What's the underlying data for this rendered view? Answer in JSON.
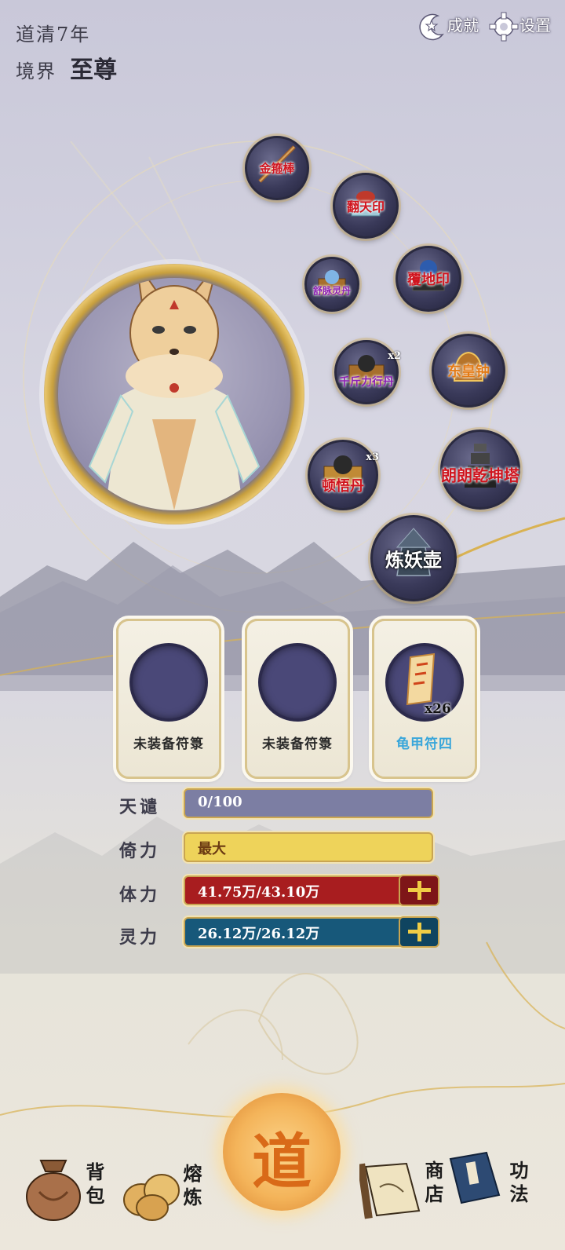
{
  "header": {
    "age_text": "道清7年",
    "realm_label": "境界",
    "realm_value": "至尊",
    "achievements_label": "成就",
    "settings_label": "设置"
  },
  "artifacts": [
    {
      "label": "金箍棒",
      "style": "red",
      "icon": "staff-icon"
    },
    {
      "label": "翻天印",
      "style": "red",
      "icon": "seal-icon"
    },
    {
      "label": "舒脉灵丹",
      "style": "purple",
      "icon": "chest-orb-icon"
    },
    {
      "label": "覆地印",
      "style": "red",
      "icon": "box-orb-icon"
    },
    {
      "label": "千斤力行丹",
      "style": "purple",
      "icon": "chest-ball-icon",
      "count": "x2"
    },
    {
      "label": "东皇钟",
      "style": "red",
      "icon": "bell-icon"
    },
    {
      "label": "顿悟丹",
      "style": "red",
      "icon": "chest-ball-icon",
      "count": "x3"
    },
    {
      "label": "朗朗乾坤塔",
      "style": "red",
      "icon": "tower-icon"
    },
    {
      "label": "炼妖壶",
      "style": "red",
      "icon": "pot-icon"
    }
  ],
  "talismans": [
    {
      "label": "未装备符箓",
      "equipped": false
    },
    {
      "label": "未装备符箓",
      "equipped": false
    },
    {
      "label": "龟甲符四",
      "equipped": true,
      "count": "x26"
    }
  ],
  "stats": {
    "tianqian": {
      "label": "天谴",
      "value": "0/100",
      "fill": 0.0
    },
    "yili": {
      "label": "倚力",
      "value": "最大",
      "fill": 1.0
    },
    "tili": {
      "label": "体力",
      "value": "41.75万/43.10万",
      "fill": 0.969
    },
    "lingli": {
      "label": "灵力",
      "value": "26.12万/26.12万",
      "fill": 1.0
    }
  },
  "nav": {
    "bag": "背包",
    "smelt": "熔炼",
    "dao": "道",
    "shop": "商店",
    "skills": "功法"
  },
  "colors": {
    "red_label": "#d0141e",
    "purple_label": "#8d1fb3",
    "gold_bar": "#eed35a",
    "red_bar": "#a81d1f",
    "blue_bar": "#17587a",
    "gray_bar": "#7c7ea3"
  }
}
